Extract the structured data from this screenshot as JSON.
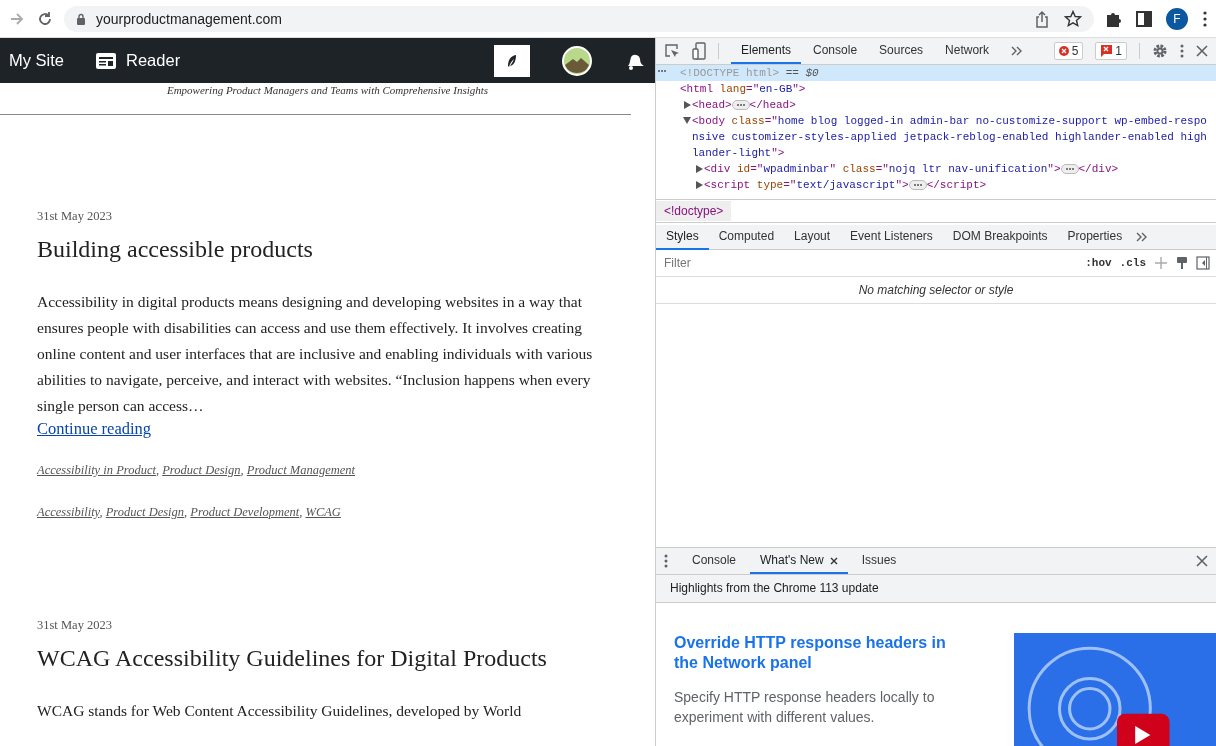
{
  "browser": {
    "url": "yourproductmanagement.com",
    "profile_initial": "F"
  },
  "admin_bar": {
    "items": [
      {
        "label": "My Site",
        "kind": "text"
      },
      {
        "label": "Reader",
        "kind": "reader"
      }
    ]
  },
  "site": {
    "tagline": "Empowering Product Managers and Teams with Comprehensive Insights",
    "separator": ", ",
    "posts": [
      {
        "date": "31st May 2023",
        "title": "Building accessible products",
        "excerpt": "Accessibility in digital products means designing and developing websites in a way that ensures people with disabilities can access and use them effectively. It involves creating online content and user interfaces that are inclusive and enabling individuals with various abilities to navigate, perceive, and interact with websites. “Inclusion happens when every single person can access…",
        "more_link": "Continue reading",
        "categories": [
          "Accessibility in Product",
          "Product Design",
          "Product Management"
        ],
        "tags": [
          "Accessibility",
          "Product Design",
          "Product Development",
          "WCAG"
        ]
      },
      {
        "date": "31st May 2023",
        "title": "WCAG Accessibility Guidelines for Digital Products",
        "excerpt": "WCAG stands for Web Content Accessibility Guidelines, developed by World"
      }
    ]
  },
  "devtools": {
    "tabs": [
      {
        "label": "Elements",
        "selected": true
      },
      {
        "label": "Console",
        "selected": false
      },
      {
        "label": "Sources",
        "selected": false
      },
      {
        "label": "Network",
        "selected": false
      }
    ],
    "error_count": "5",
    "issue_count": "1",
    "dom": [
      {
        "selected": true,
        "parts": [
          {
            "kind": "doctype",
            "text": "<!DOCTYPE html>"
          },
          {
            "kind": "marker",
            "text": " == $0"
          }
        ]
      },
      {
        "selected": false,
        "parts": [
          {
            "kind": "tag",
            "text": "<html"
          },
          {
            "kind": "attr",
            "text": " lang"
          },
          {
            "kind": "punct",
            "text": "=\""
          },
          {
            "kind": "value",
            "text": "en-GB"
          },
          {
            "kind": "punct",
            "text": "\">"
          }
        ],
        "children": [
          {
            "selected": false,
            "expanded": false,
            "parts": [
              {
                "kind": "tag",
                "text": "<head>"
              },
              {
                "kind": "collapsed"
              },
              {
                "kind": "tag",
                "text": "</head>"
              }
            ]
          },
          {
            "selected": false,
            "expanded": true,
            "parts": [
              {
                "kind": "tag",
                "text": "<body"
              },
              {
                "kind": "attr",
                "text": " class"
              },
              {
                "kind": "punct",
                "text": "=\""
              },
              {
                "kind": "value",
                "text": "home blog logged-in admin-bar no-customize-support wp-embed-responsive customizer-styles-applied jetpack-reblog-enabled highlander-enabled highlander-light"
              },
              {
                "kind": "punct",
                "text": "\">"
              }
            ],
            "children": [
              {
                "selected": false,
                "expanded": false,
                "parts": [
                  {
                    "kind": "tag",
                    "text": "<div"
                  },
                  {
                    "kind": "attr",
                    "text": " id"
                  },
                  {
                    "kind": "punct",
                    "text": "=\""
                  },
                  {
                    "kind": "value",
                    "text": "wpadminbar"
                  },
                  {
                    "kind": "punct",
                    "text": "\""
                  },
                  {
                    "kind": "attr",
                    "text": " class"
                  },
                  {
                    "kind": "punct",
                    "text": "=\""
                  },
                  {
                    "kind": "value",
                    "text": "nojq ltr nav-unification"
                  },
                  {
                    "kind": "punct",
                    "text": "\">"
                  },
                  {
                    "kind": "collapsed"
                  },
                  {
                    "kind": "tag",
                    "text": "</div>"
                  }
                ]
              },
              {
                "selected": false,
                "expanded": false,
                "parts": [
                  {
                    "kind": "tag",
                    "text": "<script"
                  },
                  {
                    "kind": "attr",
                    "text": " type"
                  },
                  {
                    "kind": "punct",
                    "text": "=\""
                  },
                  {
                    "kind": "value",
                    "text": "text/javascript"
                  },
                  {
                    "kind": "punct",
                    "text": "\">"
                  },
                  {
                    "kind": "collapsed"
                  },
                  {
                    "kind": "tag",
                    "text": "</script>"
                  }
                ]
              }
            ]
          }
        ]
      }
    ],
    "breadcrumb": "<!doctype>",
    "style_tabs": [
      {
        "label": "Styles",
        "selected": true
      },
      {
        "label": "Computed",
        "selected": false
      },
      {
        "label": "Layout",
        "selected": false
      },
      {
        "label": "Event Listeners",
        "selected": false
      },
      {
        "label": "DOM Breakpoints",
        "selected": false
      },
      {
        "label": "Properties",
        "selected": false
      }
    ],
    "filter_placeholder": "Filter",
    "hov": ":hov",
    "cls": ".cls",
    "empty_note": "No matching selector or style",
    "drawer": {
      "tabs": [
        {
          "label": "Console",
          "selected": false,
          "closable": false
        },
        {
          "label": "What's New",
          "selected": true,
          "closable": true
        },
        {
          "label": "Issues",
          "selected": false,
          "closable": false
        }
      ],
      "banner": "Highlights from the Chrome 113 update",
      "article": {
        "title": "Override HTTP response headers in the Network panel",
        "body": "Specify HTTP response headers locally to experiment with different values."
      }
    }
  }
}
